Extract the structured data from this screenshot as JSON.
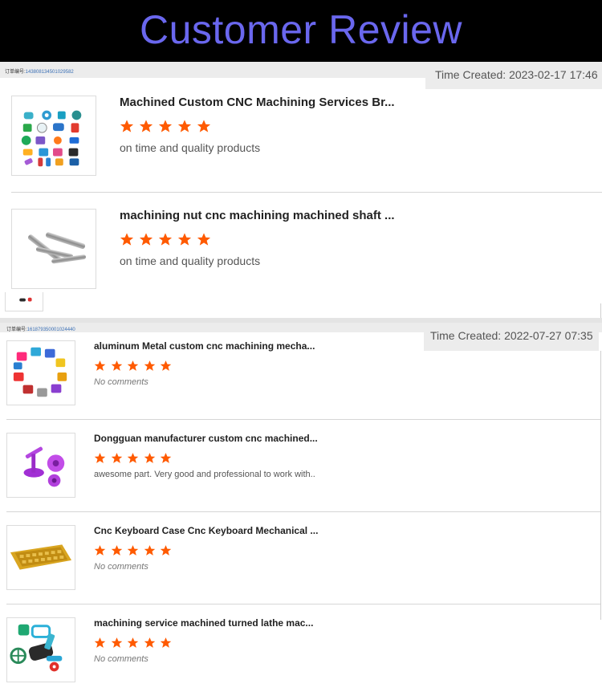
{
  "header": {
    "title": "Customer Review"
  },
  "colors": {
    "banner_bg": "#000000",
    "title": "#6a67ee",
    "star": "#ff5a00"
  },
  "orders": [
    {
      "order_label": "订单编号:",
      "order_number": "143808134501029582",
      "time_created": "Time Created: 2023-02-17 17:46",
      "items": [
        {
          "title": "Machined Custom CNC Machining Services Br...",
          "rating": 5,
          "comment": "on time and quality products",
          "thumb_icon": "colorful-cnc-parts-icon"
        },
        {
          "title": "machining nut cnc machining machined shaft ...",
          "rating": 5,
          "comment": "on time and quality products",
          "thumb_icon": "metal-shafts-icon"
        }
      ]
    },
    {
      "order_label": "订单编号:",
      "order_number": "161879350001024440",
      "time_created": "Time Created: 2022-07-27 07:35",
      "items": [
        {
          "title": "aluminum Metal custom cnc machining mecha...",
          "rating": 5,
          "comment": "No comments",
          "thumb_icon": "anodized-aluminum-parts-icon"
        },
        {
          "title": "Dongguan manufacturer custom cnc machined...",
          "rating": 5,
          "comment": "awesome part. Very good and professional to work with..",
          "thumb_icon": "purple-knob-parts-icon"
        },
        {
          "title": "Cnc Keyboard Case Cnc Keyboard Mechanical ...",
          "rating": 5,
          "comment": "No comments",
          "thumb_icon": "gold-keyboard-case-icon"
        },
        {
          "title": "machining service machined turned lathe mac...",
          "rating": 5,
          "comment": "No comments",
          "thumb_icon": "turned-lathe-parts-icon"
        }
      ]
    }
  ]
}
